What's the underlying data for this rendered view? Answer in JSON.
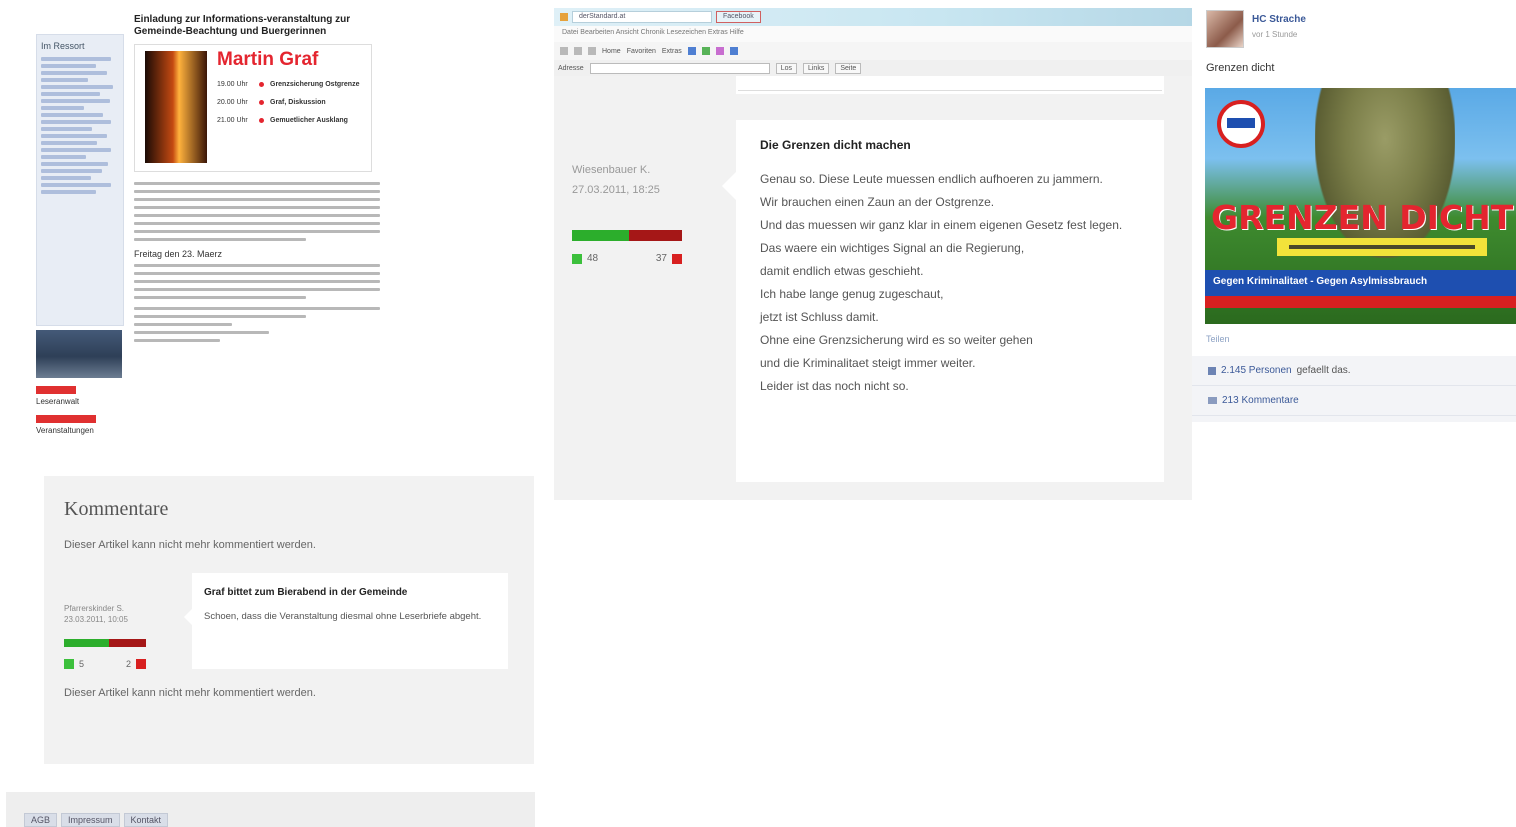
{
  "article": {
    "nav_heading": "Im Ressort",
    "thumb_caption_1": "Leseranwalt",
    "thumb_caption_2": "Veranstaltungen",
    "title": "Einladung zur Informations-veranstaltung zur Gemeinde-Beachtung und Buergerinnen",
    "flyer_name": "Martin Graf",
    "flyer_rows": [
      {
        "time": "19.00 Uhr",
        "desc": "Grenzsicherung Ostgrenze"
      },
      {
        "time": "20.00 Uhr",
        "desc": "Graf, Diskussion"
      },
      {
        "time": "21.00 Uhr",
        "desc": "Gemuetlicher Ausklang"
      }
    ],
    "subheading": "Freitag den 23. Maerz"
  },
  "comments": {
    "heading": "Kommentare",
    "closed_note": "Dieser Artikel kann nicht mehr kommentiert werden.",
    "footer_note": "Dieser Artikel kann nicht mehr kommentiert werden.",
    "item": {
      "author": "Pfarrerskinder S.",
      "date": "23.03.2011, 10:05",
      "title": "Graf bittet zum Bierabend in der Gemeinde",
      "text": "Schoen, dass die Veranstaltung diesmal ohne Leserbriefe abgeht.",
      "up": "5",
      "down": "2",
      "up_share": 0.55
    }
  },
  "footer": {
    "links": [
      "AGB",
      "Impressum",
      "Kontakt"
    ]
  },
  "browser": {
    "tabs": [
      "derStandard.at",
      "Facebook"
    ],
    "menu": "Datei  Bearbeiten  Ansicht  Chronik  Lesezeichen  Extras  Hilfe",
    "tool_labels": [
      "Home",
      "Favoriten",
      "Extras"
    ],
    "addr_label": "Adresse",
    "addr_btn_1": "Los",
    "addr_btn_2": "Links",
    "addr_btn_3": "Seite"
  },
  "comment2": {
    "author": "Wiesenbauer K.",
    "date": "27.03.2011, 18:25",
    "title": "Die Grenzen dicht machen",
    "text": "Genau so. Diese Leute muessen endlich aufhoeren zu jammern.\nWir brauchen einen Zaun an der Ostgrenze.\nUnd das muessen wir ganz klar in einem eigenen Gesetz fest legen.\nDas waere ein wichtiges Signal an die Regierung,\ndamit endlich etwas geschieht.\nIch habe lange genug zugeschaut,\njetzt ist Schluss damit.\nOhne eine Grenzsicherung wird es so weiter gehen\nund die Kriminalitaet steigt immer weiter.\nLeider ist das noch nicht so.",
    "up": "48",
    "down": "37",
    "up_share": 0.52
  },
  "social": {
    "name": "HC Strache",
    "time": "vor 1 Stunde",
    "post_text": "Grenzen dicht",
    "image_slogan": "GRENZEN DICHT!",
    "image_band": "Gegen Kriminalitaet - Gegen Asylmissbrauch",
    "link": "Teilen",
    "likes_link": "2.145 Personen",
    "likes_text": "gefaellt das.",
    "comments_link": "213 Kommentare"
  },
  "colors": {
    "vote_green": "#2cae2c",
    "vote_red": "#a51717",
    "flyer_red": "#e4252f",
    "fb_blue": "#3b5998"
  }
}
